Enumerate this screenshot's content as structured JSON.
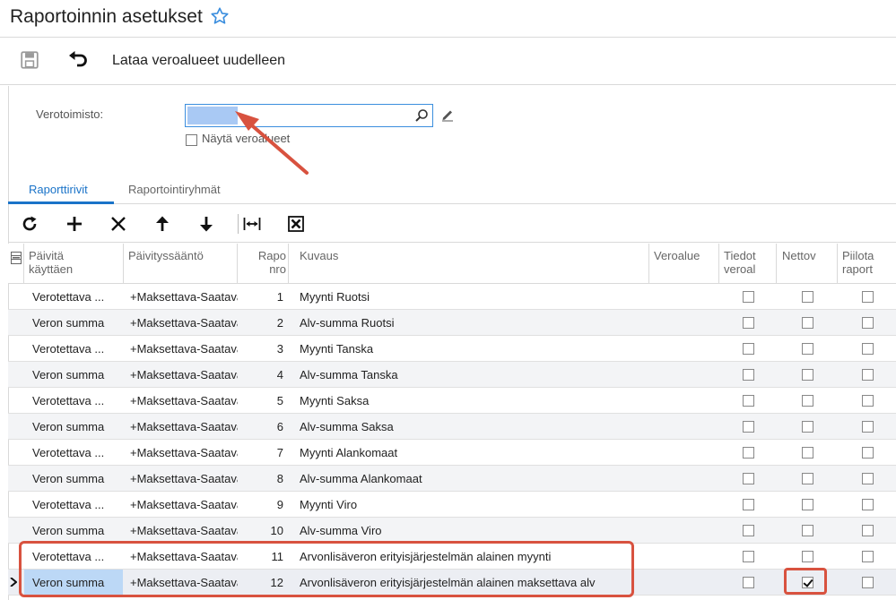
{
  "header": {
    "title": "Raportoinnin asetukset"
  },
  "toolbar": {
    "reload_label": "Lataa veroalueet uudelleen"
  },
  "form": {
    "tax_office_label": "Verotoimisto:",
    "tax_office_value": "",
    "show_regions_label": "Näytä veroalueet",
    "show_regions_checked": false
  },
  "tabs": [
    {
      "label": "Raporttirivit",
      "active": true
    },
    {
      "label": "Raportointiryhmät",
      "active": false
    }
  ],
  "grid_toolbar": [
    "refresh-icon",
    "add-icon",
    "delete-icon",
    "move-up-icon",
    "move-down-icon",
    "fit-columns-icon",
    "export-excel-icon"
  ],
  "columns": [
    {
      "line1": "Päivitä",
      "line2": "käyttäen"
    },
    {
      "line1": "Päivityssääntö",
      "line2": ""
    },
    {
      "line1": "Rapo",
      "line2": "nro"
    },
    {
      "line1": "Kuvaus",
      "line2": ""
    },
    {
      "line1": "Veroalue",
      "line2": ""
    },
    {
      "line1": "Tiedot",
      "line2": "veroal"
    },
    {
      "line1": "Nettov",
      "line2": ""
    },
    {
      "line1": "Piilota",
      "line2": "raport"
    }
  ],
  "rows": [
    {
      "update_using": "Verotettava ...",
      "rule": "+Maksettava-Saatava",
      "report_no": "1",
      "description": "Myynti Ruotsi",
      "region": "",
      "details": false,
      "net": false,
      "hide": false
    },
    {
      "update_using": "Veron summa",
      "rule": "+Maksettava-Saatava",
      "report_no": "2",
      "description": "Alv-summa Ruotsi",
      "region": "",
      "details": false,
      "net": false,
      "hide": false
    },
    {
      "update_using": "Verotettava ...",
      "rule": "+Maksettava-Saatava",
      "report_no": "3",
      "description": "Myynti Tanska",
      "region": "",
      "details": false,
      "net": false,
      "hide": false
    },
    {
      "update_using": "Veron summa",
      "rule": "+Maksettava-Saatava",
      "report_no": "4",
      "description": "Alv-summa Tanska",
      "region": "",
      "details": false,
      "net": false,
      "hide": false
    },
    {
      "update_using": "Verotettava ...",
      "rule": "+Maksettava-Saatava",
      "report_no": "5",
      "description": "Myynti Saksa",
      "region": "",
      "details": false,
      "net": false,
      "hide": false
    },
    {
      "update_using": "Veron summa",
      "rule": "+Maksettava-Saatava",
      "report_no": "6",
      "description": "Alv-summa Saksa",
      "region": "",
      "details": false,
      "net": false,
      "hide": false
    },
    {
      "update_using": "Verotettava ...",
      "rule": "+Maksettava-Saatava",
      "report_no": "7",
      "description": "Myynti Alankomaat",
      "region": "",
      "details": false,
      "net": false,
      "hide": false
    },
    {
      "update_using": "Veron summa",
      "rule": "+Maksettava-Saatava",
      "report_no": "8",
      "description": "Alv-summa Alankomaat",
      "region": "",
      "details": false,
      "net": false,
      "hide": false
    },
    {
      "update_using": "Verotettava ...",
      "rule": "+Maksettava-Saatava",
      "report_no": "9",
      "description": "Myynti Viro",
      "region": "",
      "details": false,
      "net": false,
      "hide": false
    },
    {
      "update_using": "Veron summa",
      "rule": "+Maksettava-Saatava",
      "report_no": "10",
      "description": "Alv-summa Viro",
      "region": "",
      "details": false,
      "net": false,
      "hide": false
    },
    {
      "update_using": "Verotettava ...",
      "rule": "+Maksettava-Saatava",
      "report_no": "11",
      "description": "Arvonlisäveron erityisjärjestelmän alainen myynti",
      "region": "",
      "details": false,
      "net": false,
      "hide": false
    },
    {
      "update_using": "Veron summa",
      "rule": "+Maksettava-Saatava",
      "report_no": "12",
      "description": "Arvonlisäveron erityisjärjestelmän alainen maksettava alv",
      "region": "",
      "details": false,
      "net": true,
      "hide": false,
      "selected": true
    }
  ],
  "colors": {
    "accent": "#1a73c8",
    "annotation": "#d8523f",
    "row_alt": "#f3f4f6",
    "selected_cell": "#bcd8f6"
  }
}
